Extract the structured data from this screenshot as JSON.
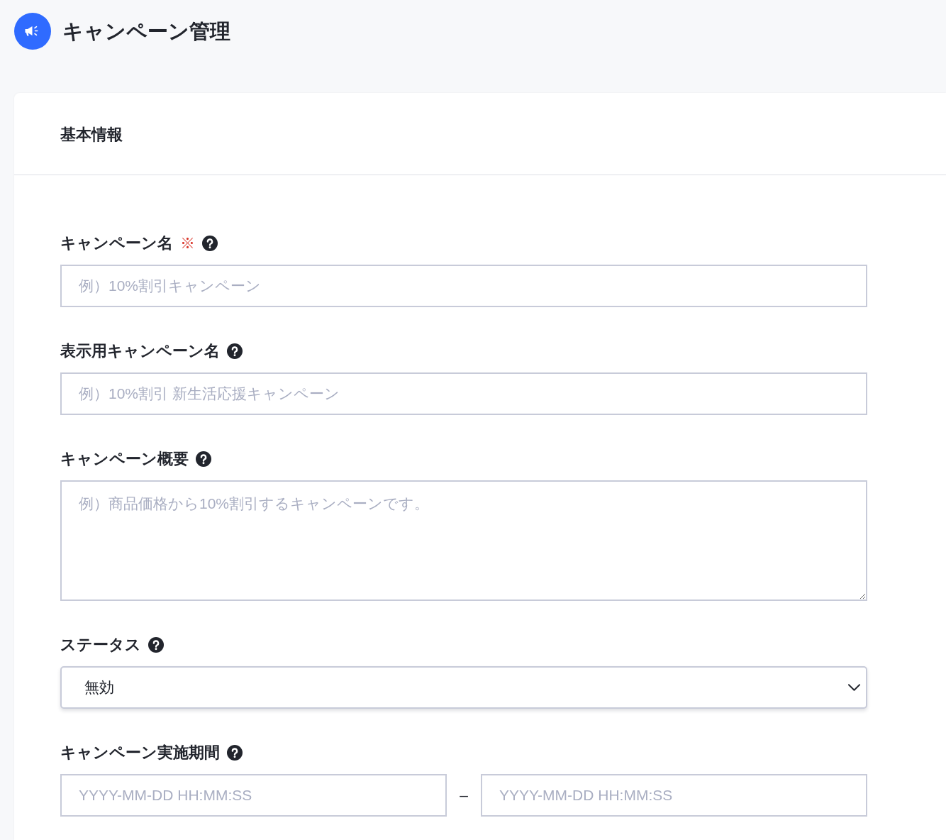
{
  "header": {
    "title": "キャンペーン管理"
  },
  "card": {
    "title": "基本情報",
    "fields": [
      {
        "kind": "text",
        "label": "キャンペーン名",
        "required_mark": "※",
        "help": true,
        "placeholder": "例）10%割引キャンペーン"
      },
      {
        "kind": "text",
        "label": "表示用キャンペーン名",
        "help": true,
        "placeholder": "例）10%割引 新生活応援キャンペーン"
      },
      {
        "kind": "textarea",
        "label": "キャンペーン概要",
        "help": true,
        "placeholder": "例）商品価格から10%割引するキャンペーンです。"
      },
      {
        "kind": "select",
        "label": "ステータス",
        "help": true,
        "value": "無効"
      },
      {
        "kind": "date_range",
        "label": "キャンペーン実施期間",
        "help": true,
        "start_placeholder": "YYYY-MM-DD HH:MM:SS",
        "separator": "–",
        "end_placeholder": "YYYY-MM-DD HH:MM:SS"
      }
    ]
  }
}
